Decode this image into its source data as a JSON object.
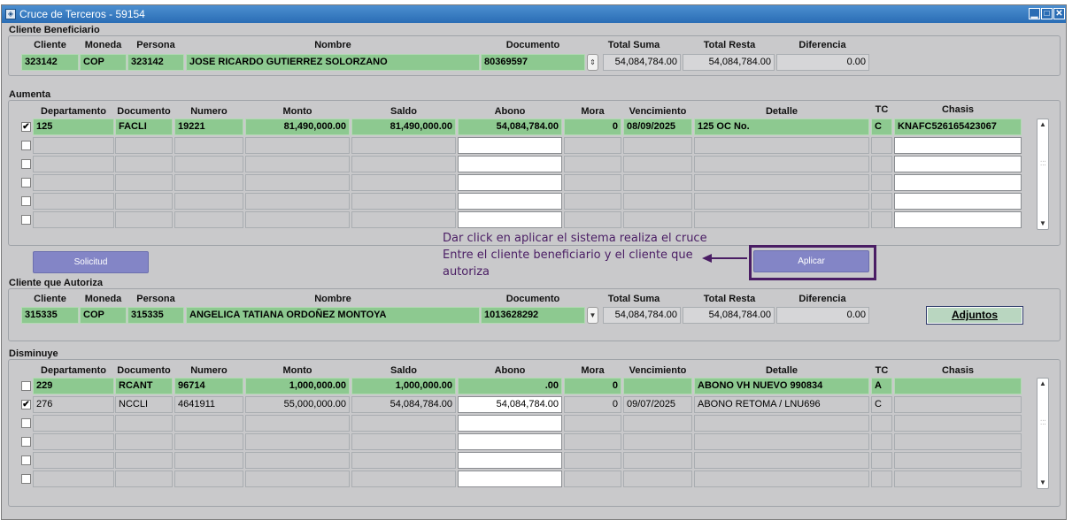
{
  "window": {
    "title": "Cruce de Terceros - 59154"
  },
  "beneficiario": {
    "section_title": "Cliente Beneficiario",
    "headers": [
      "Cliente",
      "Moneda",
      "Persona",
      "Nombre",
      "Documento",
      "Total Suma",
      "Total Resta",
      "Diferencia"
    ],
    "cliente": "323142",
    "moneda": "COP",
    "persona": "323142",
    "nombre": "JOSE RICARDO GUTIERREZ SOLORZANO",
    "documento": "80369597",
    "total_suma": "54,084,784.00",
    "total_resta": "54,084,784.00",
    "diferencia": "0.00"
  },
  "aumenta": {
    "section_title": "Aumenta",
    "headers": [
      "Departamento",
      "Documento",
      "Numero",
      "Monto",
      "Saldo",
      "Abono",
      "Mora",
      "Vencimiento",
      "Detalle",
      "TC",
      "Chasis"
    ],
    "rows": [
      {
        "checked": "✔",
        "departamento": "125",
        "documento": "FACLI",
        "numero": "19221",
        "monto": "81,490,000.00",
        "saldo": "81,490,000.00",
        "abono": "54,084,784.00",
        "mora": "0",
        "vencimiento": "08/09/2025",
        "detalle": "125 OC No.",
        "tc": "C",
        "chasis": "KNAFC526165423067"
      }
    ]
  },
  "buttons": {
    "solicitud": "Solicitud",
    "aplicar": "Aplicar",
    "adjuntos": "Adjuntos"
  },
  "annotation": {
    "line1": "Dar click en aplicar el sistema realiza el cruce",
    "line2": "Entre el cliente beneficiario y el cliente que",
    "line3": "autoriza"
  },
  "autoriza": {
    "section_title": "Cliente que Autoriza",
    "headers": [
      "Cliente",
      "Moneda",
      "Persona",
      "Nombre",
      "Documento",
      "Total Suma",
      "Total Resta",
      "Diferencia"
    ],
    "cliente": "315335",
    "moneda": "COP",
    "persona": "315335",
    "nombre": "ANGELICA TATIANA ORDOÑEZ MONTOYA",
    "documento": "1013628292",
    "total_suma": "54,084,784.00",
    "total_resta": "54,084,784.00",
    "diferencia": "0.00"
  },
  "disminuye": {
    "section_title": "Disminuye",
    "headers": [
      "Departamento",
      "Documento",
      "Numero",
      "Monto",
      "Saldo",
      "Abono",
      "Mora",
      "Vencimiento",
      "Detalle",
      "TC",
      "Chasis"
    ],
    "rows": [
      {
        "checked": "",
        "departamento": "229",
        "documento": "RCANT",
        "numero": "96714",
        "monto": "1,000,000.00",
        "saldo": "1,000,000.00",
        "abono": ".00",
        "mora": "0",
        "vencimiento": "",
        "detalle": "ABONO VH NUEVO 990834",
        "tc": "A",
        "chasis": ""
      },
      {
        "checked": "✔",
        "departamento": "276",
        "documento": "NCCLI",
        "numero": "4641911",
        "monto": "55,000,000.00",
        "saldo": "54,084,784.00",
        "abono": "54,084,784.00",
        "mora": "0",
        "vencimiento": "09/07/2025",
        "detalle": "ABONO RETOMA / LNU696",
        "tc": "C",
        "chasis": ""
      }
    ]
  }
}
